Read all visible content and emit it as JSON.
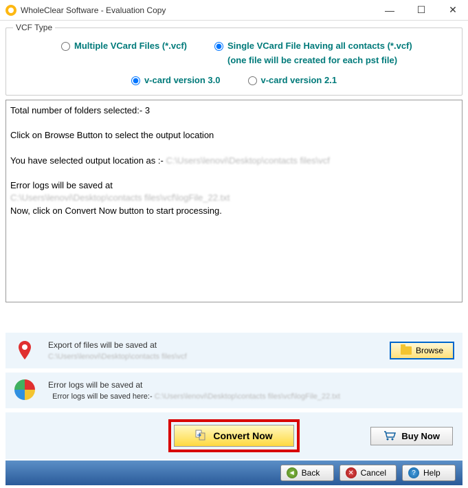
{
  "titlebar": {
    "title": "WholeClear Software - Evaluation Copy"
  },
  "vcf": {
    "legend": "VCF Type",
    "multiple": "Multiple VCard Files (*.vcf)",
    "single_line1": "Single VCard File Having all contacts (*.vcf)",
    "single_line2": "(one file will be created for each pst file)",
    "v30": "v-card version 3.0",
    "v21": "v-card version 2.1"
  },
  "log": {
    "line1": "Total number of folders selected:- 3",
    "line2": "Click on Browse Button to select the output location",
    "line3a": "You have selected output location as :- ",
    "line3b": "C:\\Users\\lenovi\\Desktop\\contacts files\\vcf",
    "line4": "Error logs will be saved at",
    "line5": "C:\\Users\\lenovi\\Desktop\\contacts files\\vcf\\logFile_22.txt",
    "line6": "Now, click on Convert Now button to start processing."
  },
  "export_row": {
    "label": "Export of files will be saved at",
    "path": "C:\\Users\\lenovi\\Desktop\\contacts files\\vcf",
    "browse": "Browse"
  },
  "error_row": {
    "label": "Error logs will be saved at",
    "sub": "Error logs will be saved here:- ",
    "path": "C:\\Users\\lenovi\\Desktop\\contacts files\\vcf\\logFile_22.txt"
  },
  "buttons": {
    "convert": "Convert Now",
    "buy": "Buy Now",
    "back": "Back",
    "cancel": "Cancel",
    "help": "Help"
  }
}
